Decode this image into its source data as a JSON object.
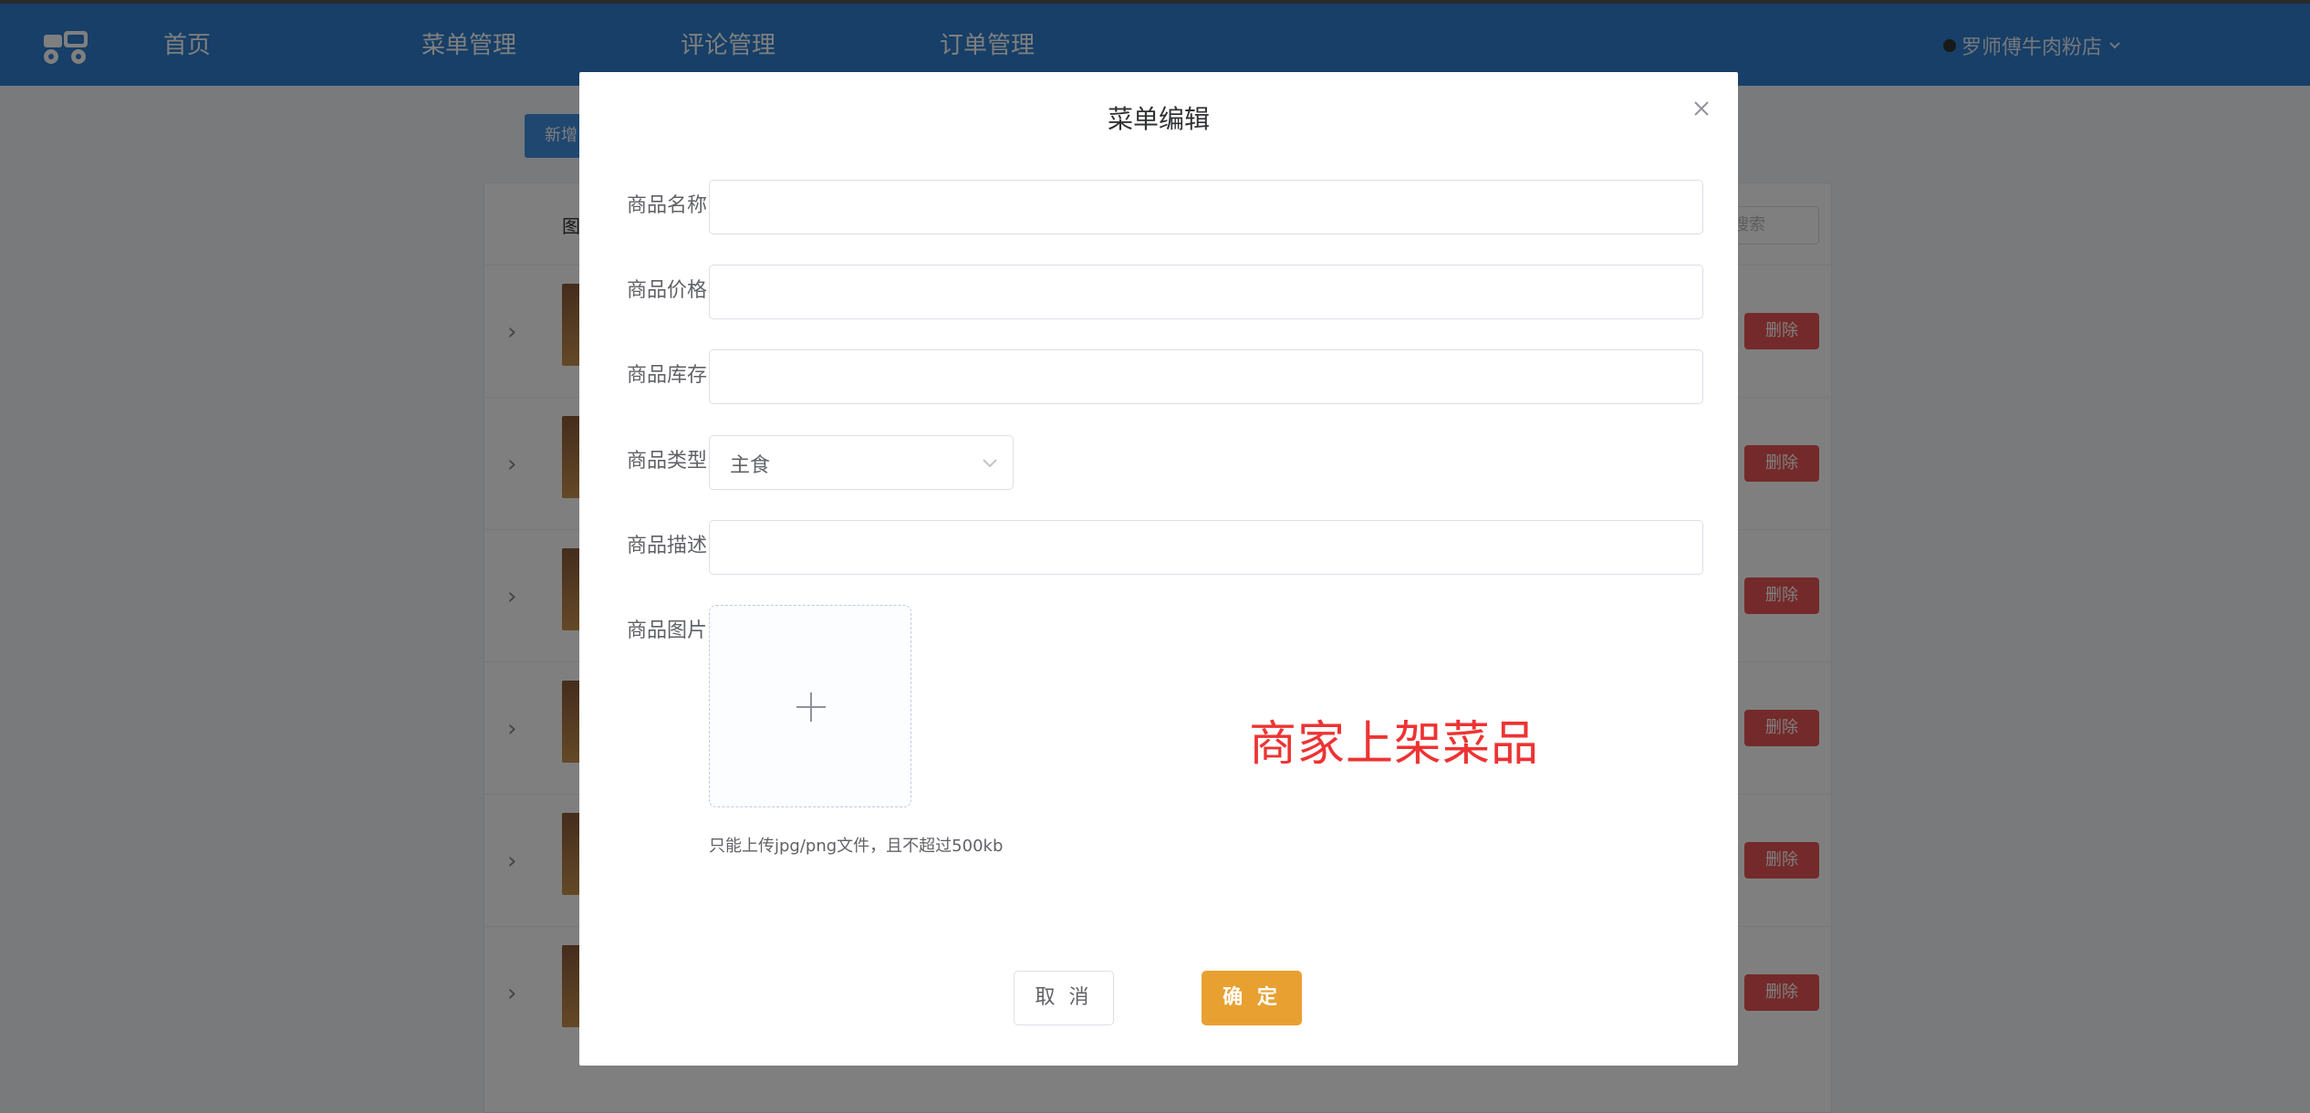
{
  "header": {
    "nav": [
      {
        "label": "首页"
      },
      {
        "label": "菜单管理"
      },
      {
        "label": "评论管理"
      },
      {
        "label": "订单管理"
      }
    ],
    "shop_name": "罗师傅牛肉粉店",
    "colors": {
      "header": "#2f7fce",
      "confirm": "#e8a031",
      "delete": "#e85555",
      "banner": "#ee3333"
    }
  },
  "page": {
    "add_label": "新增",
    "table_header": "图",
    "search_placeholder": "搜索",
    "delete_label": "删除"
  },
  "dialog": {
    "title": "菜单编辑",
    "fields": {
      "name_label": "商品名称",
      "price_label": "商品价格",
      "stock_label": "商品库存",
      "type_label": "商品类型",
      "type_value": "主食",
      "desc_label": "商品描述",
      "image_label": "商品图片"
    },
    "upload_tip": "只能上传jpg/png文件，且不超过500kb",
    "cancel_label": "取 消",
    "confirm_label": "确 定"
  },
  "annotation": {
    "text": "商家上架菜品"
  }
}
